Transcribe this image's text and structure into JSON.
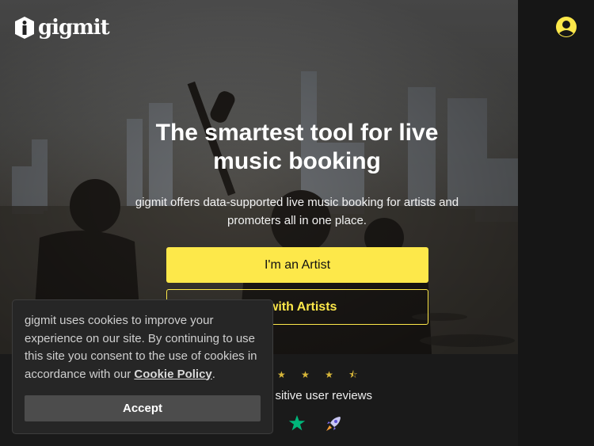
{
  "header": {
    "logo_text": "gigmit",
    "logo_icon": "gigmit-logo-icon",
    "account_icon": "user-circle-icon"
  },
  "hero": {
    "headline": "The smartest tool for live music booking",
    "subtext": "gigmit offers data-supported live music booking for artists and promoters all in one place.",
    "primary_button": "I'm an Artist",
    "secondary_button_visible": "k with Artists"
  },
  "reviews": {
    "stars_visible": "★ ★ ★ ⯪",
    "text_visible": "sitive user reviews",
    "icons": [
      "trustpilot-star-icon",
      "rocket-icon"
    ]
  },
  "cookie_banner": {
    "text_before_link": "gigmit uses cookies to improve your experience on our site. By continuing to use this site you consent to the use of cookies in accordance with our ",
    "link_text": "Cookie Policy",
    "text_after_link": ".",
    "accept_label": "Accept"
  },
  "colors": {
    "accent": "#fde84a",
    "panel": "#161616",
    "cookie_bg": "#262626",
    "accept_bg": "#4c4c4c",
    "trustpilot": "#00b67a"
  }
}
